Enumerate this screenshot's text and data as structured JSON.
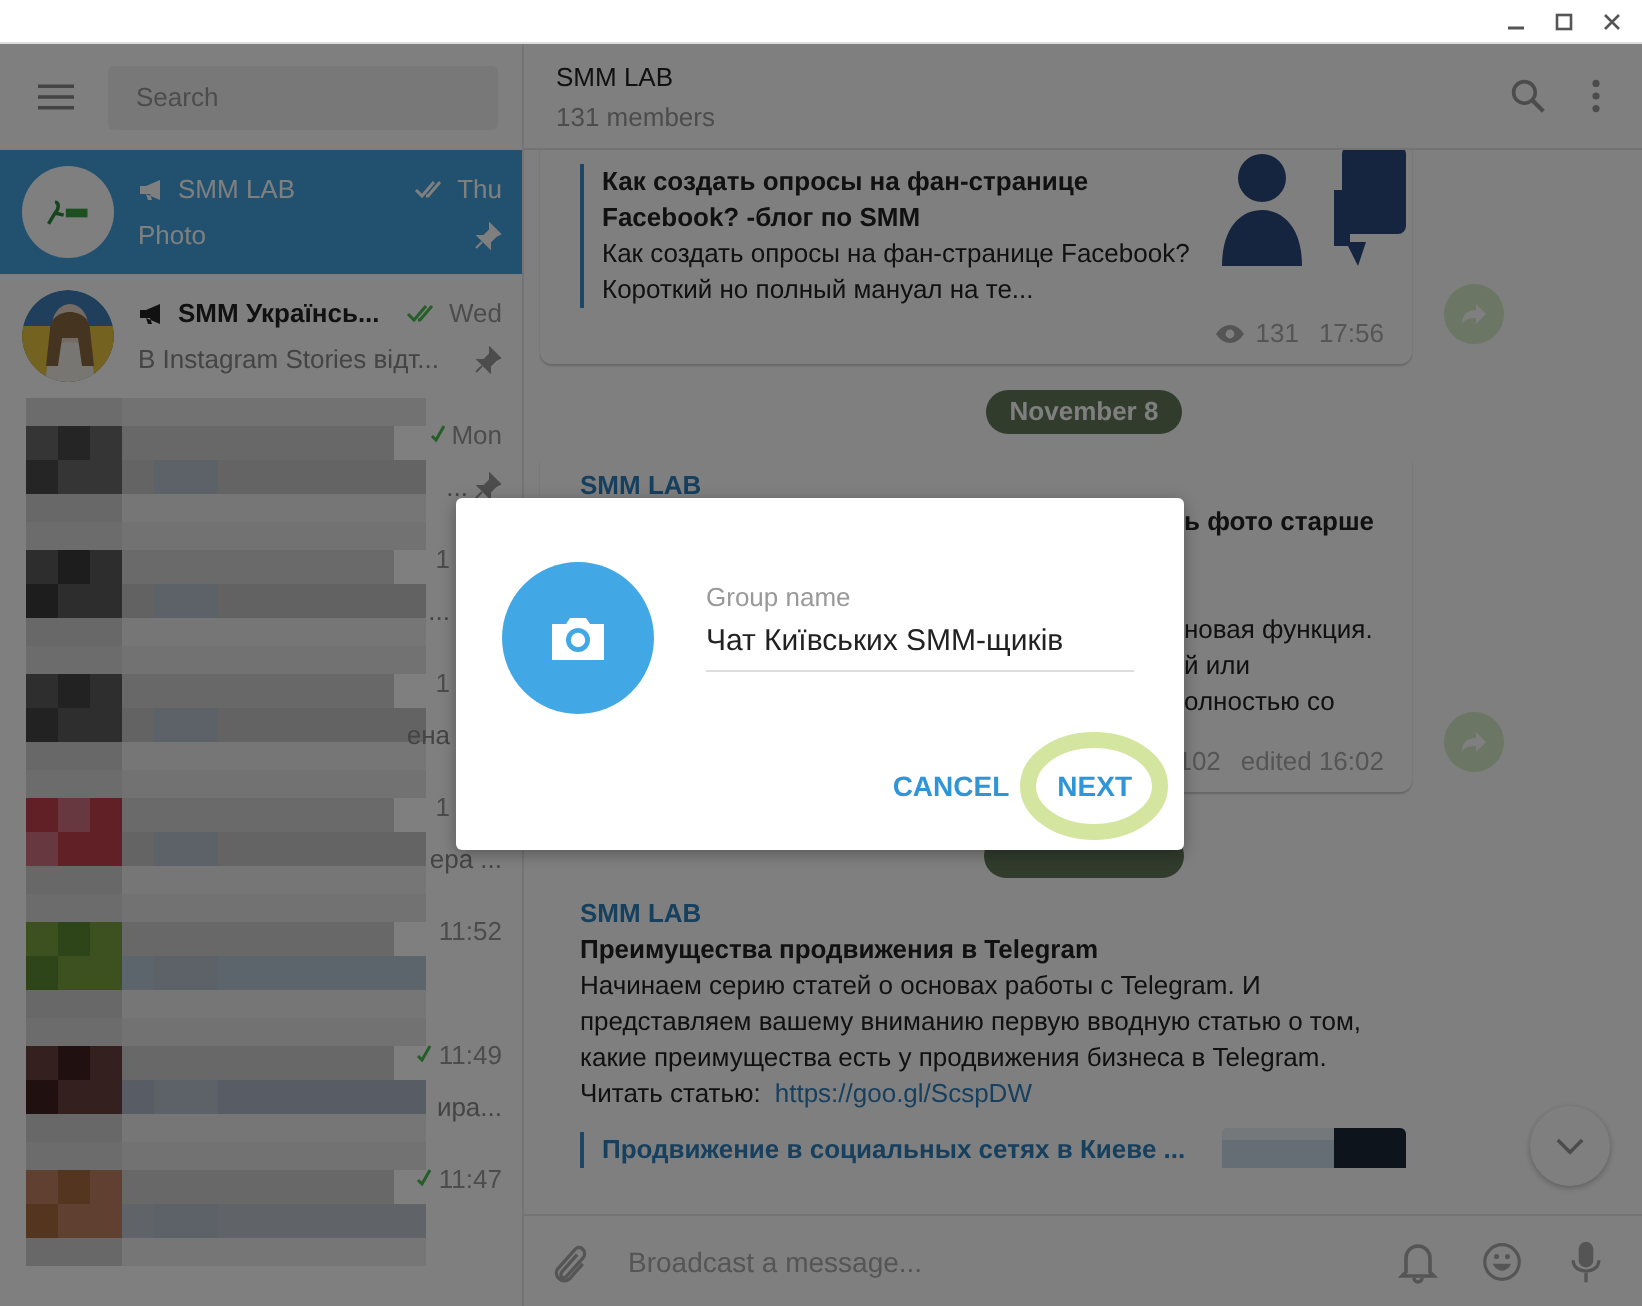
{
  "sidebar": {
    "search": {
      "placeholder": "Search"
    },
    "chats": [
      {
        "kind": "logo_chat",
        "name": "SMM LAB",
        "channel": true,
        "time": "Thu",
        "read": true,
        "snippet": "Photo",
        "pinned": true,
        "selected": true
      },
      {
        "kind": "photo_chat",
        "name": "SMM Українсь...",
        "channel": true,
        "time": "Wed",
        "read": true,
        "snippet": "В Instagram Stories відт...",
        "pinned": true,
        "selected": false
      },
      {
        "kind": "blurred",
        "time": "Mon",
        "read": true,
        "snippet": "...",
        "pinned": true,
        "selected": false
      },
      {
        "kind": "blurred",
        "time": "1",
        "read": false,
        "snippet": "...",
        "pinned": false,
        "selected": false
      },
      {
        "kind": "blurred",
        "time": "1",
        "read": false,
        "snippet": "ена",
        "pinned": false,
        "selected": false
      },
      {
        "kind": "blurred",
        "time": "1",
        "read": false,
        "snippet": "ера ...",
        "pinned": false,
        "selected": false
      },
      {
        "kind": "blurred",
        "time": "11:52",
        "read": false,
        "pinned": false,
        "selected": false
      },
      {
        "kind": "blurred",
        "time": "11:49",
        "read": true,
        "snippet": "ира...",
        "pinned": false,
        "selected": false
      },
      {
        "kind": "blurred",
        "time": "11:47",
        "read": true,
        "pinned": false,
        "selected": false
      }
    ]
  },
  "chat": {
    "title": "SMM LAB",
    "subtitle": "131 members",
    "message_1": {
      "preview_title": "Как создать опросы на фан-странице Facebook? -блог по SMM",
      "preview_text": "Как создать опросы на фан-странице Facebook? Короткий но полный мануал на те...",
      "views": "131",
      "time": "17:56"
    },
    "date_1": "November 8",
    "message_2": {
      "sender": "SMM LAB",
      "lines": [
        {
          "kind": "bold",
          "text": "ь фото старше"
        },
        {
          "kind": "text",
          "text": "новая функция."
        },
        {
          "kind": "text",
          "text": "й или"
        },
        {
          "kind": "text",
          "text": "олностью со"
        }
      ],
      "views": "102",
      "time": "edited 16:02"
    },
    "message_3": {
      "sender": "SMM LAB",
      "title": "Преимущества продвижения в Telegram",
      "text": "Начинаем серию статей о основах работы с Telegram. И представляем вашему вниманию первую вводную статью о том, какие преимущества есть у продвижения бизнеса в Telegram.",
      "link_label": "Читать статью:",
      "link": "https://goo.gl/ScspDW",
      "preview_site": "Продвижение в социальных сетях в Киеве ..."
    },
    "input": {
      "placeholder": "Broadcast a message..."
    }
  },
  "dialog": {
    "field_label": "Group name",
    "field_value": "Чат Київських SMM-щиків",
    "buttons": [
      {
        "label": "CANCEL",
        "highlighted": false
      },
      {
        "label": "NEXT",
        "highlighted": true
      }
    ]
  }
}
